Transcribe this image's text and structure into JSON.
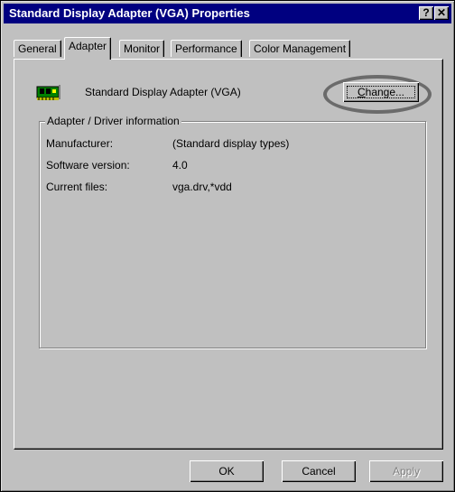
{
  "window": {
    "title": "Standard Display Adapter (VGA) Properties",
    "help_glyph": "?",
    "close_glyph": "✕"
  },
  "tabs": [
    {
      "label": "General",
      "active": false
    },
    {
      "label": "Adapter",
      "active": true
    },
    {
      "label": "Monitor",
      "active": false
    },
    {
      "label": "Performance",
      "active": false
    },
    {
      "label": "Color Management",
      "active": false
    }
  ],
  "adapter": {
    "icon": "display-adapter-card-icon",
    "name": "Standard Display Adapter (VGA)",
    "change_button": {
      "accel": "C",
      "rest": "hange..."
    }
  },
  "driver_info": {
    "group_label": "Adapter / Driver information",
    "manufacturer_label": "Manufacturer:",
    "manufacturer_value": "(Standard display types)",
    "software_version_label": "Software version:",
    "software_version_value": "4.0",
    "current_files_label": "Current files:",
    "current_files_value": "vga.drv,*vdd"
  },
  "buttons": {
    "ok": "OK",
    "cancel": "Cancel",
    "apply": "Apply",
    "apply_enabled": false
  },
  "colors": {
    "titlebar": "#000080",
    "face": "#c0c0c0",
    "highlight_ring": "#6b6b6b"
  }
}
